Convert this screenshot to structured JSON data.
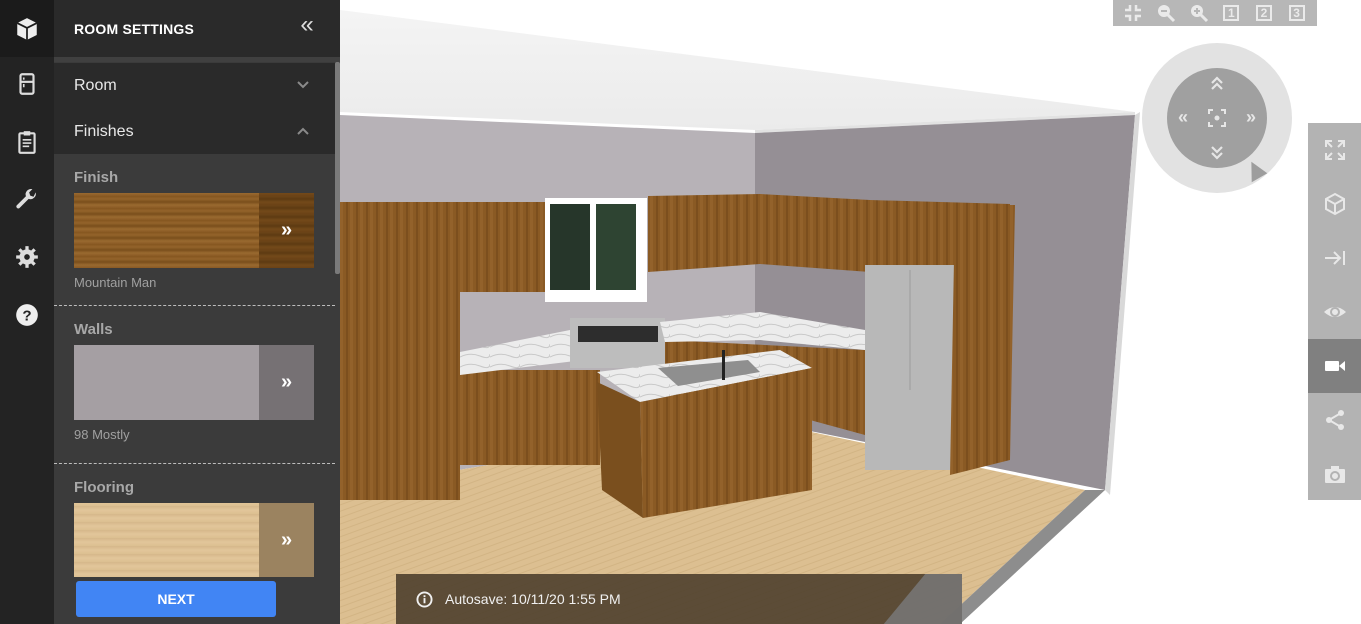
{
  "rail": {
    "items": [
      {
        "name": "room-design",
        "icon": "cube-icon",
        "active": true
      },
      {
        "name": "appliances",
        "icon": "refrigerator-icon",
        "active": false
      },
      {
        "name": "summary",
        "icon": "clipboard-icon",
        "active": false
      },
      {
        "name": "tools",
        "icon": "wrench-icon",
        "active": false
      },
      {
        "name": "settings",
        "icon": "gear-icon",
        "active": false
      },
      {
        "name": "help",
        "icon": "help-icon",
        "active": false
      }
    ]
  },
  "panel": {
    "title": "ROOM SETTINGS",
    "collapse_icon": "«",
    "accordion": [
      {
        "label": "Room",
        "expanded": false
      },
      {
        "label": "Finishes",
        "expanded": true
      }
    ],
    "finishes": [
      {
        "label": "Finish",
        "value": "Mountain Man",
        "color": "#8a5a24"
      },
      {
        "label": "Walls",
        "value": "98 Mostly",
        "color": "#a59fa3"
      },
      {
        "label": "Flooring",
        "value": "",
        "color": "#dcbf91"
      }
    ],
    "swatch_arrow": "»",
    "next_label": "NEXT"
  },
  "top_toolbar": {
    "items": [
      "exit-fullscreen",
      "zoom-out",
      "zoom-in",
      "1",
      "2",
      "3"
    ]
  },
  "nav_dial": {
    "up": "︽",
    "down": "︾",
    "left": "«",
    "right": "»"
  },
  "right_toolbar": {
    "items": [
      {
        "name": "fullscreen",
        "active": false
      },
      {
        "name": "3d-view",
        "active": false
      },
      {
        "name": "jump-to",
        "active": false
      },
      {
        "name": "visibility",
        "active": false
      },
      {
        "name": "camera-video",
        "active": true
      },
      {
        "name": "share",
        "active": false
      },
      {
        "name": "screenshot",
        "active": false
      }
    ]
  },
  "status": {
    "autosave": "Autosave: 10/11/20 1:55 PM"
  },
  "colors": {
    "accent": "#4185f4",
    "cabinet": "#8a5a24",
    "wall": "#a9a4a9",
    "floor": "#dcbf91"
  }
}
